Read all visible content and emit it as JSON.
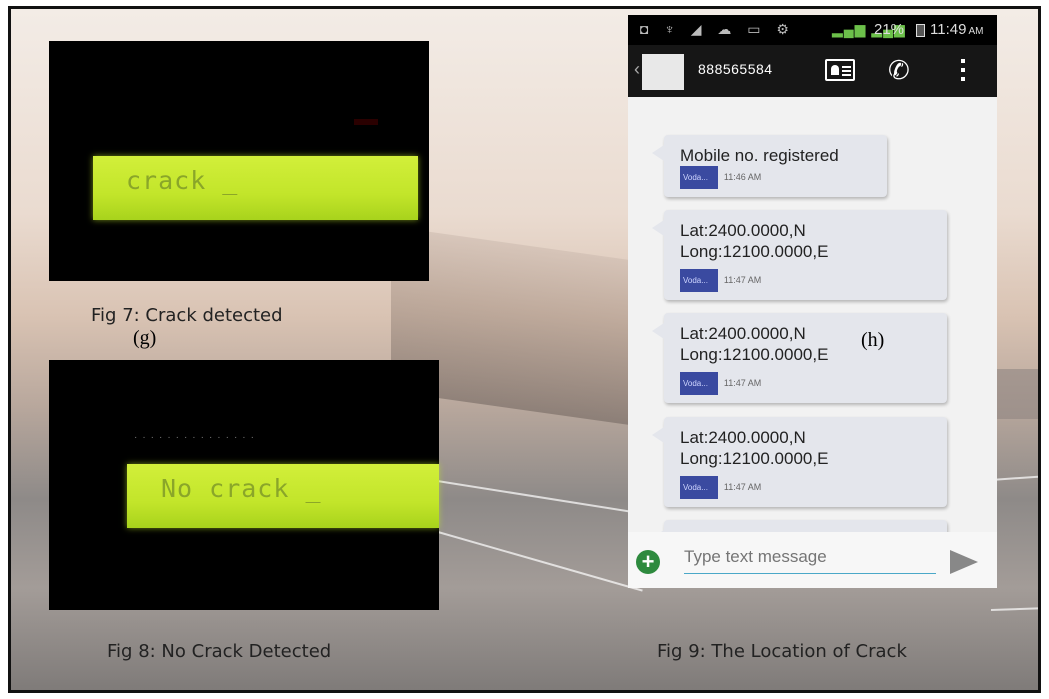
{
  "figures": {
    "fig7": {
      "lcd_text": "crack _",
      "caption": "Fig 7: Crack detected",
      "label": "(g)"
    },
    "fig8": {
      "lcd_text": "No crack _",
      "caption": "Fig 8: No Crack Detected"
    },
    "fig9": {
      "caption": "Fig 9: The Location of Crack",
      "label": "(h)"
    }
  },
  "phone": {
    "status": {
      "battery": "21%",
      "time": "11:49",
      "ampm": "AM"
    },
    "contact_number": "888565584",
    "messages": [
      {
        "text": "Mobile no. registered",
        "carrier": "Voda...",
        "time": "11:46 AM"
      },
      {
        "text": "Lat:2400.0000,N\nLong:12100.0000,E",
        "carrier": "Voda...",
        "time": "11:47 AM"
      },
      {
        "text": "Lat:2400.0000,N\nLong:12100.0000,E",
        "carrier": "Voda...",
        "time": "11:47 AM"
      },
      {
        "text": "Lat:2400.0000,N\nLong:12100.0000,E",
        "carrier": "Voda...",
        "time": "11:47 AM"
      }
    ],
    "compose": {
      "placeholder": "Type text message"
    }
  },
  "colors": {
    "lcd_green": "#c8e830",
    "lcd_text": "#8aa629",
    "add_icon": "#2e8a3e",
    "input_underline": "#4aa8c8"
  }
}
